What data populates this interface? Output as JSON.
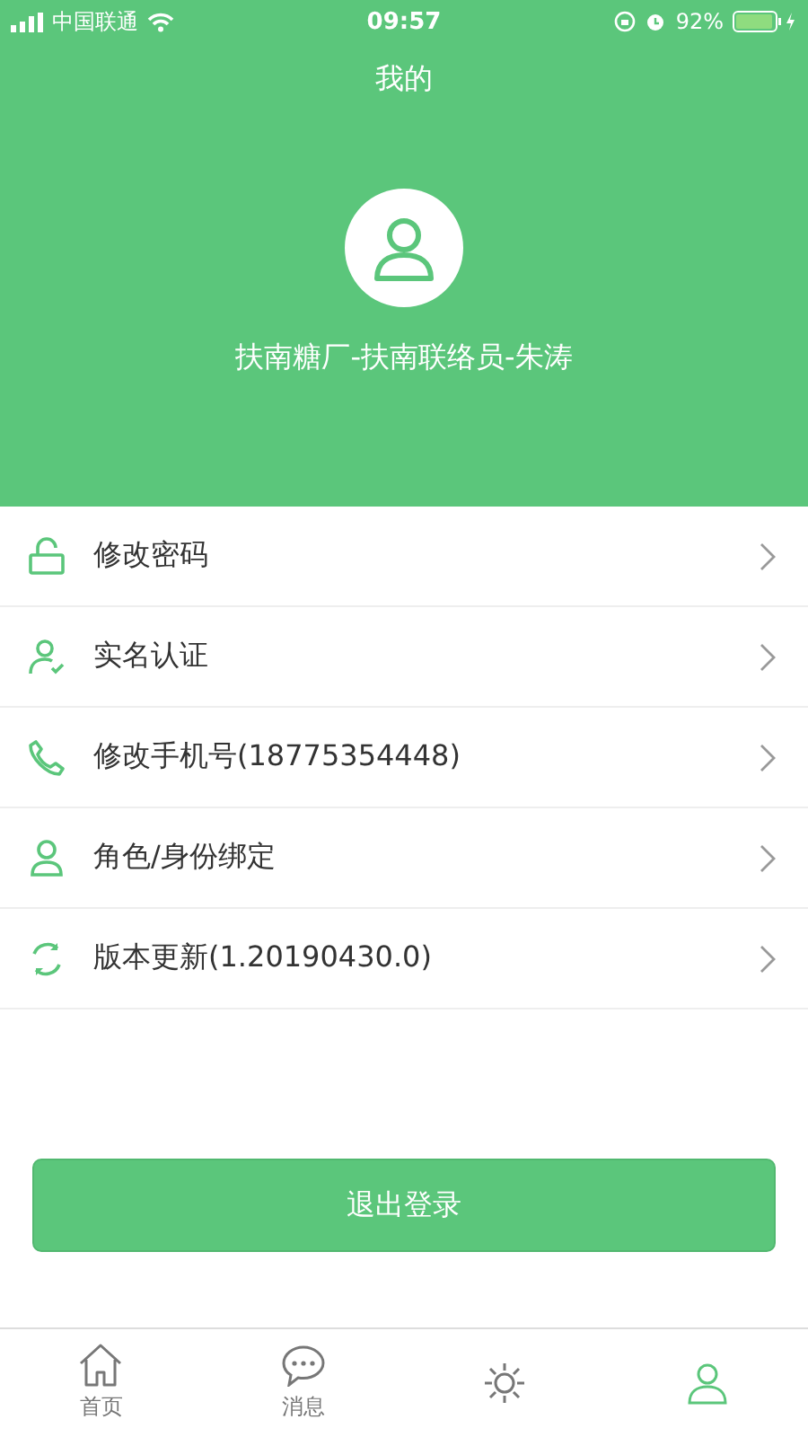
{
  "status_bar": {
    "carrier": "中国联通",
    "time": "09:57",
    "battery": "92%"
  },
  "header": {
    "title": "我的",
    "user_name": "扶南糖厂-扶南联络员-朱涛"
  },
  "menu": [
    {
      "kind": "lock",
      "label": "修改密码"
    },
    {
      "kind": "verify",
      "label": "实名认证"
    },
    {
      "kind": "phone",
      "label": "修改手机号(18775354448)"
    },
    {
      "kind": "person",
      "label": "角色/身份绑定"
    },
    {
      "kind": "update",
      "label": "版本更新(1.20190430.0)"
    }
  ],
  "logout_button": "退出登录",
  "tabs": [
    {
      "kind": "home",
      "label": "首页",
      "selected": false
    },
    {
      "kind": "message",
      "label": "消息",
      "selected": false
    },
    {
      "kind": "sun",
      "selected": false
    },
    {
      "kind": "person",
      "selected": true
    }
  ]
}
